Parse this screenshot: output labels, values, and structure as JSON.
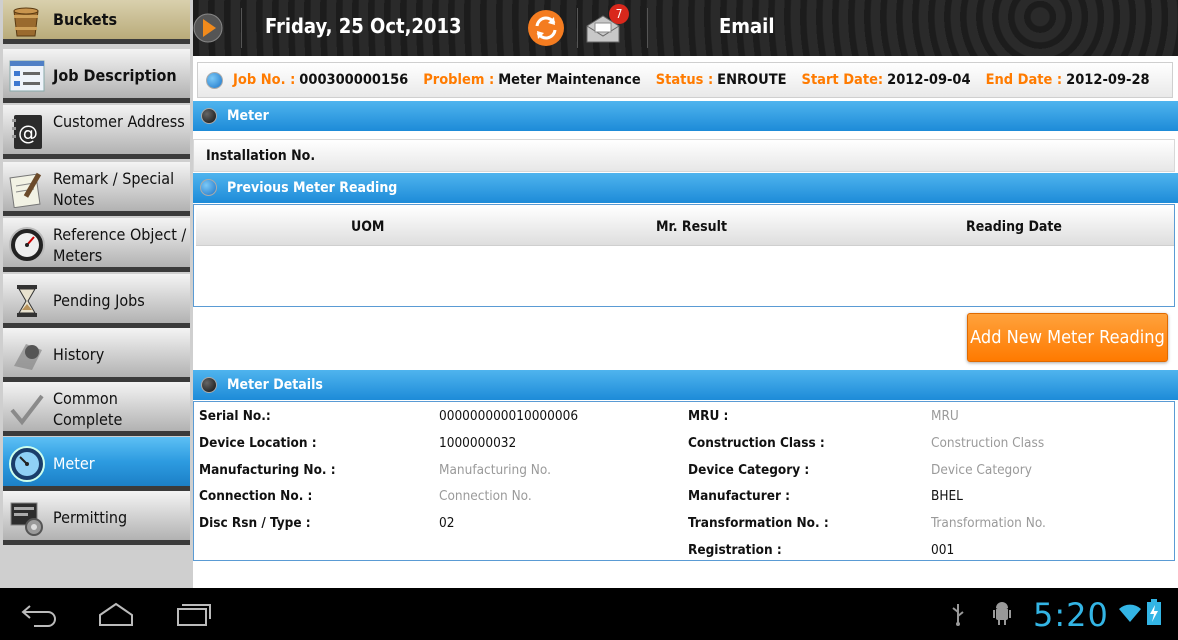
{
  "sidebar": {
    "items": [
      {
        "label": "Buckets",
        "icon": "bucket-icon",
        "active": false
      },
      {
        "label": "Job Description",
        "icon": "checklist-icon",
        "active": false
      },
      {
        "label": "Customer Address",
        "icon": "address-book-icon",
        "active": false
      },
      {
        "label": "Remark / Special Notes",
        "icon": "notepad-icon",
        "active": false
      },
      {
        "label": "Reference Object / Meters",
        "icon": "gauge-icon",
        "active": false
      },
      {
        "label": "Pending Jobs",
        "icon": "hourglass-icon",
        "active": false
      },
      {
        "label": "History",
        "icon": "clock-history-icon",
        "active": false
      },
      {
        "label": "Common Complete",
        "icon": "checkmark-icon",
        "active": false
      },
      {
        "label": "Meter",
        "icon": "meter-icon",
        "active": true
      },
      {
        "label": "Permitting",
        "icon": "permit-gear-icon",
        "active": false
      }
    ]
  },
  "topbar": {
    "date": "Friday, 25 Oct,2013",
    "email_label": "Email",
    "mail_badge": "7"
  },
  "job": {
    "job_no_label": "Job No. :",
    "job_no": "000300000156",
    "problem_label": "Problem :",
    "problem": "Meter Maintenance",
    "status_label": "Status :",
    "status": "ENROUTE",
    "start_label": "Start Date:",
    "start_date": "2012-09-04",
    "end_label": "End Date :",
    "end_date": "2012-09-28"
  },
  "meter_section": {
    "title": "Meter",
    "installation_label": "Installation No."
  },
  "previous_reading": {
    "title": "Previous Meter Reading",
    "columns": [
      "UOM",
      "Mr. Result",
      "Reading Date"
    ]
  },
  "add_button_label": "Add New Meter Reading",
  "meter_details": {
    "title": "Meter Details",
    "left": [
      {
        "label": "Serial No.:",
        "value": "000000000010000006",
        "placeholder": false
      },
      {
        "label": "Device Location :",
        "value": "1000000032",
        "placeholder": false
      },
      {
        "label": "Manufacturing No. :",
        "value": "Manufacturing No.",
        "placeholder": true
      },
      {
        "label": "Connection No. :",
        "value": "Connection No.",
        "placeholder": true
      },
      {
        "label": "Disc Rsn / Type :",
        "value": "02",
        "placeholder": false
      }
    ],
    "right": [
      {
        "label": "MRU :",
        "value": "MRU",
        "placeholder": true
      },
      {
        "label": "Construction Class :",
        "value": "Construction Class",
        "placeholder": true
      },
      {
        "label": "Device Category :",
        "value": "Device Category",
        "placeholder": true
      },
      {
        "label": "Manufacturer :",
        "value": "BHEL",
        "placeholder": false
      },
      {
        "label": "Transformation No. :",
        "value": "Transformation No.",
        "placeholder": true
      },
      {
        "label": "Registration :",
        "value": "001",
        "placeholder": false
      }
    ]
  },
  "system_bar": {
    "clock": "5:20"
  },
  "colors": {
    "accent_blue": "#1d8bd8",
    "accent_orange": "#ff7a00",
    "clock_blue": "#33b5e5"
  }
}
